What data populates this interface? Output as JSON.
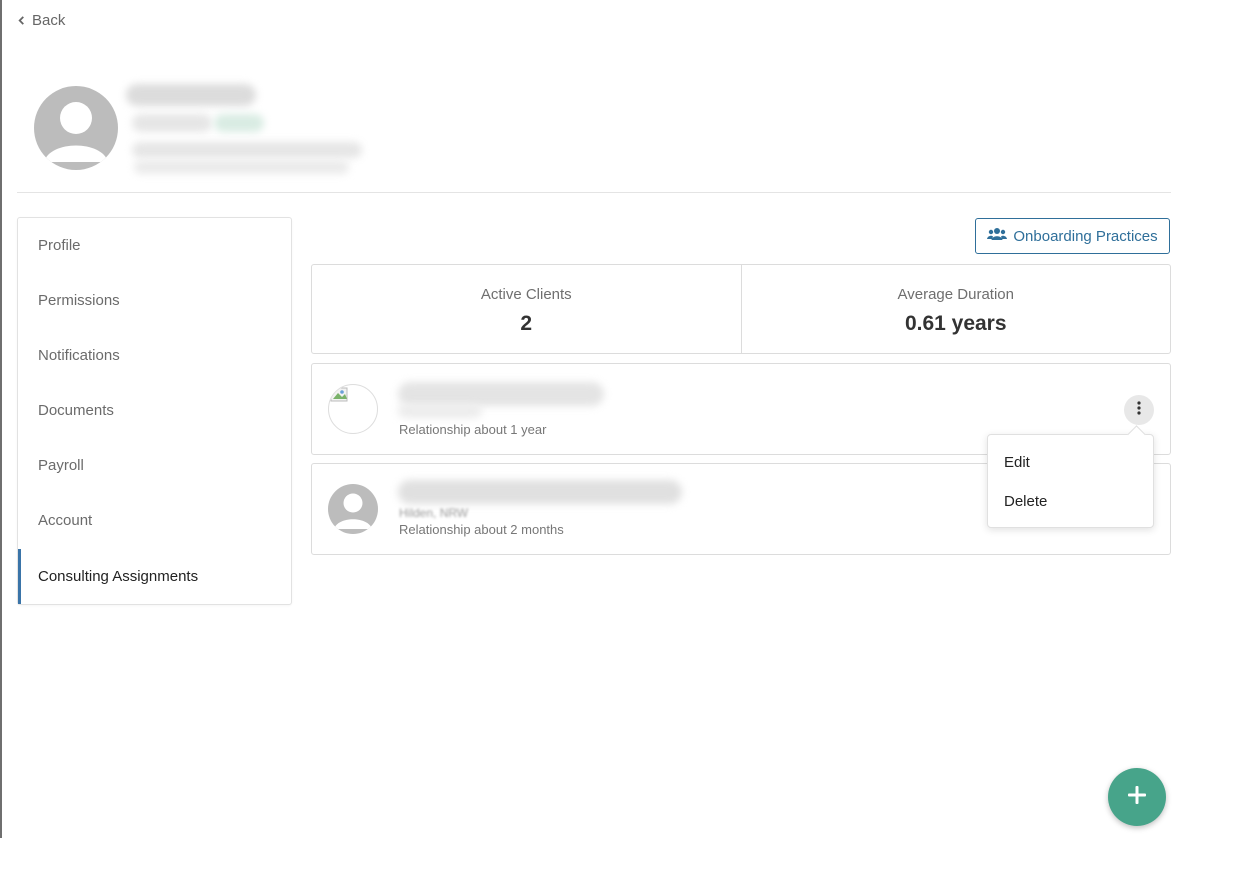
{
  "nav": {
    "back_label": "Back"
  },
  "sidebar": {
    "items": [
      {
        "label": "Profile"
      },
      {
        "label": "Permissions"
      },
      {
        "label": "Notifications"
      },
      {
        "label": "Documents"
      },
      {
        "label": "Payroll"
      },
      {
        "label": "Account"
      },
      {
        "label": "Consulting Assignments",
        "active": true
      }
    ]
  },
  "toolbar": {
    "onboarding_label": "Onboarding Practices",
    "onboarding_icon": "users-icon"
  },
  "stats": {
    "active_clients_label": "Active Clients",
    "active_clients_value": "2",
    "avg_duration_label": "Average Duration",
    "avg_duration_value": "0.61 years"
  },
  "clients": [
    {
      "relationship": "Relationship about 1 year"
    },
    {
      "location": "Hilden, NRW",
      "relationship": "Relationship about 2 months"
    }
  ],
  "context_menu": {
    "edit_label": "Edit",
    "delete_label": "Delete"
  },
  "colors": {
    "accent": "#2f6f9a",
    "active_border": "#3a74a8",
    "fab": "#47a48a"
  }
}
